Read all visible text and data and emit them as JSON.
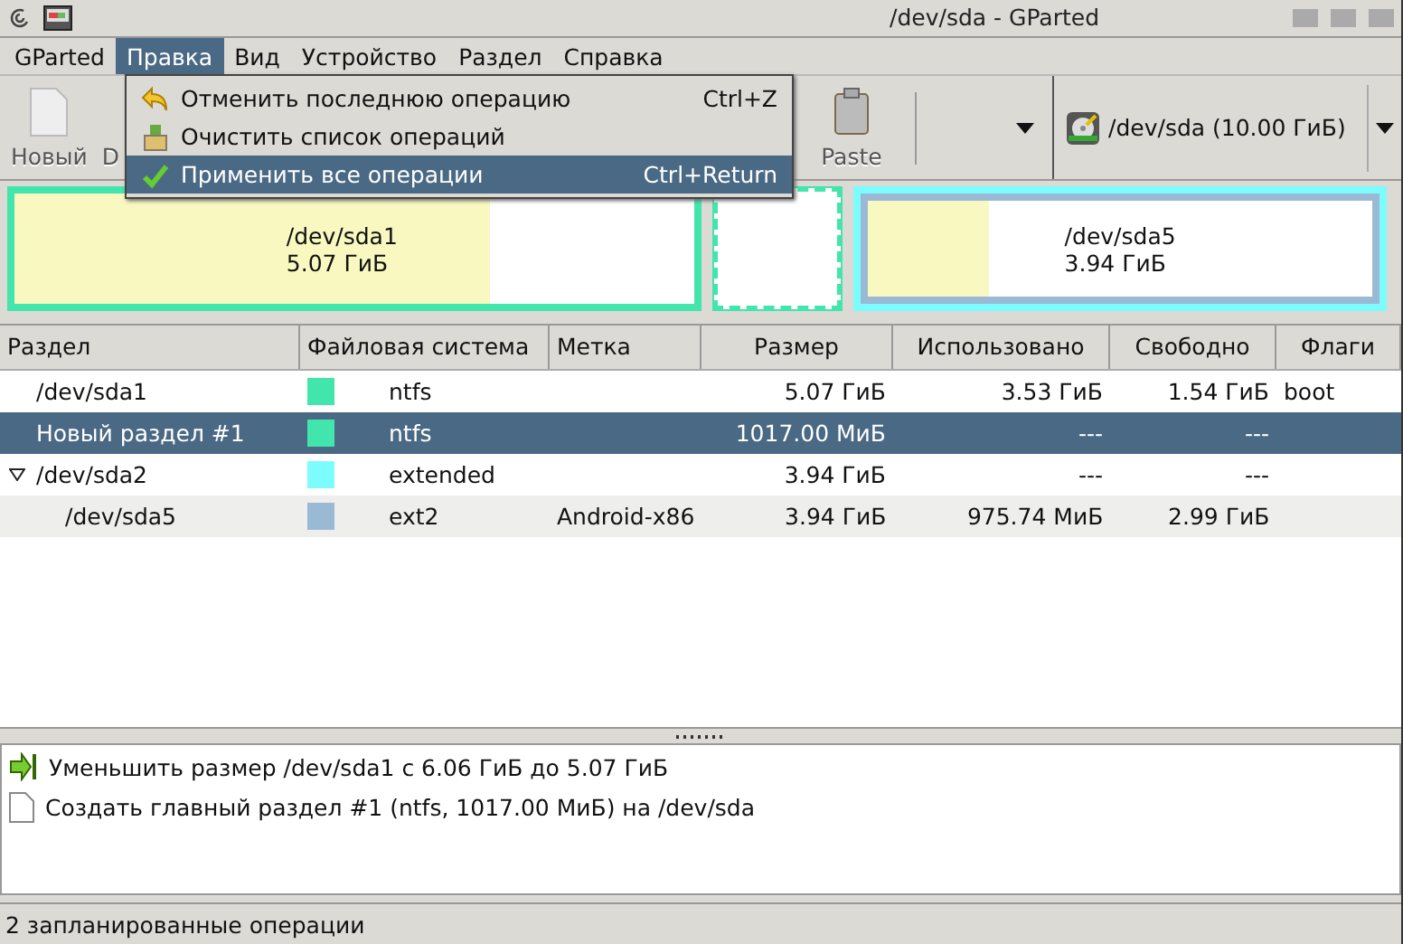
{
  "window": {
    "title": "/dev/sda - GParted"
  },
  "menubar": [
    {
      "label": "GParted",
      "selected": false
    },
    {
      "label": "Правка",
      "selected": true
    },
    {
      "label": "Вид",
      "selected": false
    },
    {
      "label": "Устройство",
      "selected": false
    },
    {
      "label": "Раздел",
      "selected": false
    },
    {
      "label": "Справка",
      "selected": false
    }
  ],
  "menu": [
    {
      "kind": "undo",
      "label": "Отменить последнюю операцию",
      "shortcut": "Ctrl+Z",
      "selected": false
    },
    {
      "kind": "clear",
      "label": "Очистить список операций",
      "selected": false
    },
    {
      "kind": "apply",
      "label": "Применить все операции",
      "shortcut": "Ctrl+Return",
      "selected": true
    }
  ],
  "toolbar": [
    {
      "kind": "new",
      "label": "Новый"
    },
    {
      "kind": "cut",
      "label": "D"
    },
    {
      "kind": "paste",
      "label": "Paste"
    }
  ],
  "device": {
    "label": "/dev/sda  (10.00 ГиБ)"
  },
  "partition_map": [
    {
      "kind": "primary",
      "name": "/dev/sda1",
      "size": "5.07 ГиБ",
      "level": 0.7
    },
    {
      "kind": "new"
    },
    {
      "kind": "extended",
      "children": [
        {
          "kind": "logical",
          "name": "/dev/sda5",
          "size": "3.94 ГиБ",
          "level": 0.24
        }
      ]
    }
  ],
  "table": {
    "columns": [
      "Раздел",
      "Файловая система",
      "Метка",
      "Размер",
      "Использовано",
      "Свободно",
      "Флаги"
    ],
    "rows": [
      {
        "partition": "/dev/sda1",
        "color": "#42e5ac",
        "filesystem": "ntfs",
        "size": "5.07 ГиБ",
        "used": "3.53 ГиБ",
        "free": "1.54 ГиБ",
        "flags": "boot",
        "selected": false
      },
      {
        "partition": "Новый раздел #1",
        "color": "#42e5ac",
        "filesystem": "ntfs",
        "size": "1017.00 МиБ",
        "used": "---",
        "free": "---",
        "selected": true
      },
      {
        "partition": "/dev/sda2",
        "color": "#7dfcfe",
        "filesystem": "extended",
        "size": "3.94 ГиБ",
        "used": "---",
        "free": "---",
        "selected": false,
        "expanded": true,
        "children": [
          {
            "partition": "/dev/sda5",
            "color": "#9ab9d5",
            "filesystem": "ext2",
            "label": "Android-x86",
            "size": "3.94 ГиБ",
            "used": "975.74 МиБ",
            "free": "2.99 ГиБ",
            "selected": false
          }
        ]
      }
    ]
  },
  "operations": [
    {
      "kind": "resize",
      "text": "Уменьшить размер /dev/sda1 с 6.06 ГиБ до 5.07 ГиБ"
    },
    {
      "kind": "create",
      "text": "Создать главный раздел #1 (ntfs, 1017.00 МиБ) на /dev/sda"
    }
  ],
  "status_bar": "2 запланированные операции"
}
